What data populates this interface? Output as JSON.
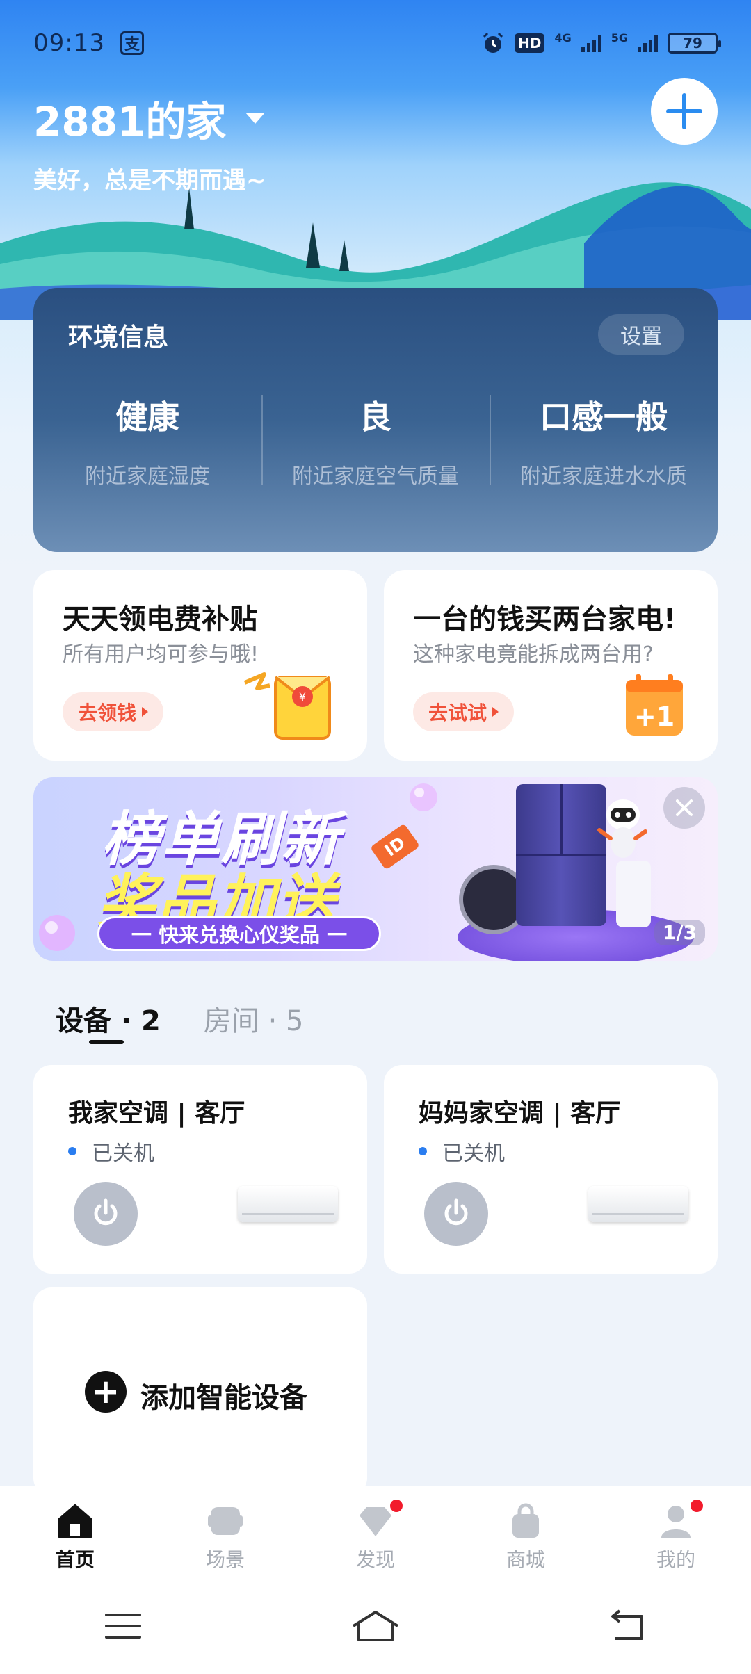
{
  "status_bar": {
    "time": "09:13",
    "pay_icon": "支",
    "hd": "HD",
    "net1": "4G",
    "net2": "5G",
    "battery": "79"
  },
  "header": {
    "home_name": "2881的家",
    "subtitle": "美好，总是不期而遇~"
  },
  "environment": {
    "title": "环境信息",
    "settings_label": "设置",
    "items": [
      {
        "value": "健康",
        "label": "附近家庭湿度"
      },
      {
        "value": "良",
        "label": "附近家庭空气质量"
      },
      {
        "value": "口感一般",
        "label": "附近家庭进水水质"
      }
    ]
  },
  "promos": [
    {
      "title": "天天领电费补贴",
      "subtitle": "所有用户均可参与哦!",
      "button": "去领钱",
      "icon": "red-envelope-icon"
    },
    {
      "title": "一台的钱买两台家电!",
      "subtitle": "这种家电竟能拆成两台用?",
      "button": "去试试",
      "icon": "plus-one-calendar-icon"
    }
  ],
  "banner": {
    "line1": "榜单刷新",
    "line2": "奖品加送",
    "pill": "一 快来兑换心仪奖品 一",
    "page_indicator": "1/3",
    "tag": "ID"
  },
  "tabs": [
    {
      "label": "设备",
      "count": "2",
      "active": true
    },
    {
      "label": "房间",
      "count": "5",
      "active": false
    }
  ],
  "devices": [
    {
      "name": "我家空调 | 客厅",
      "status": "已关机"
    },
    {
      "name": "妈妈家空调 | 客厅",
      "status": "已关机"
    }
  ],
  "add_device": {
    "label": "添加智能设备"
  },
  "bottom_nav": [
    {
      "label": "首页",
      "icon": "home-icon",
      "active": true
    },
    {
      "label": "场景",
      "icon": "scene-icon",
      "active": false
    },
    {
      "label": "发现",
      "icon": "discover-icon",
      "active": false,
      "badge": true
    },
    {
      "label": "商城",
      "icon": "shop-bag-icon",
      "active": false
    },
    {
      "label": "我的",
      "icon": "profile-icon",
      "active": false,
      "badge": true
    }
  ],
  "colors": {
    "accent": "#2a8cf0",
    "badge": "#f21b2c",
    "promo_button_text": "#f0523a",
    "env_card": "#2a4f80"
  }
}
